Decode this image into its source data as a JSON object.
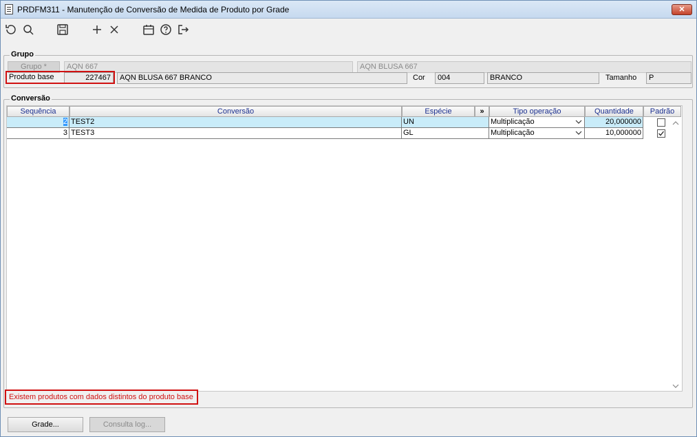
{
  "window": {
    "title": "PRDFM311 - Manutenção de Conversão de Medida de Produto por Grade",
    "close_label": "✕"
  },
  "toolbar": {
    "icons": [
      "refresh-icon",
      "search-icon",
      "save-icon",
      "add-icon",
      "delete-icon",
      "calendar-icon",
      "help-icon",
      "exit-icon"
    ]
  },
  "grupo": {
    "legend": "Grupo",
    "grupo_label": "Grupo  *",
    "grupo_code": "AQN 667",
    "grupo_desc": "AQN BLUSA 667",
    "produto_base_label": "Produto base",
    "produto_base_code": "227467",
    "produto_base_desc": "AQN BLUSA 667 BRANCO",
    "cor_label": "Cor",
    "cor_code": "004",
    "cor_desc": "BRANCO",
    "tamanho_label": "Tamanho",
    "tamanho_value": "P"
  },
  "conversao": {
    "legend": "Conversão",
    "columns": [
      "Sequência",
      "Conversão",
      "Espécie",
      "»",
      "Tipo operação",
      "Quantidade",
      "Padrão"
    ],
    "rows": [
      {
        "seq": "2",
        "conversao": "TEST2",
        "especie": "UN",
        "tipo": "Multiplicação",
        "quantidade": "20,000000",
        "padrao": false
      },
      {
        "seq": "3",
        "conversao": "TEST3",
        "especie": "GL",
        "tipo": "Multiplicação",
        "quantidade": "10,000000",
        "padrao": true
      }
    ]
  },
  "status": {
    "message": "Existem produtos com dados distintos do produto base"
  },
  "buttons": {
    "grade": "Grade...",
    "consulta_log": "Consulta log..."
  },
  "colors": {
    "accent": "#1b2f8f",
    "error": "#d01010",
    "selection": "#c9ecf9"
  }
}
